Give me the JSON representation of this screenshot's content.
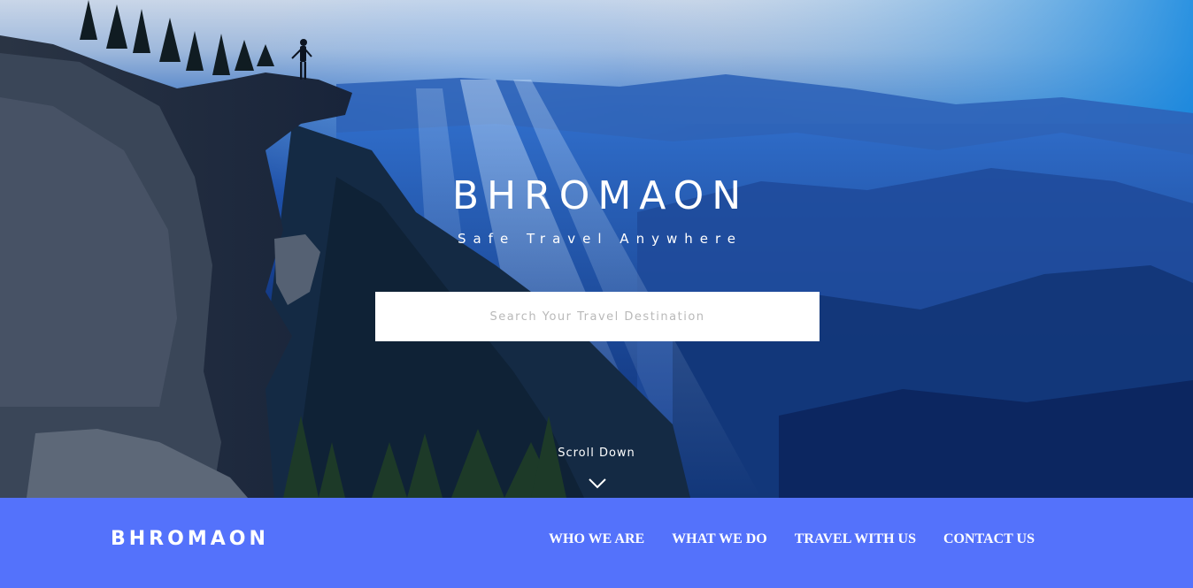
{
  "hero": {
    "title": "BHROMAON",
    "tagline": "Safe Travel Anywhere",
    "search_placeholder": "Search Your Travel Destination",
    "search_value": "",
    "scroll_label": "Scroll Down",
    "scroll_icon": "chevron-down-icon",
    "background_image": "mountain-cliff-with-hiker"
  },
  "navbar": {
    "brand": "BHROMAON",
    "links": [
      {
        "label": "WHO WE ARE"
      },
      {
        "label": "WHAT WE DO"
      },
      {
        "label": "TRAVEL WITH US"
      },
      {
        "label": "CONTACT US"
      }
    ],
    "background_color": "#5472fb"
  }
}
